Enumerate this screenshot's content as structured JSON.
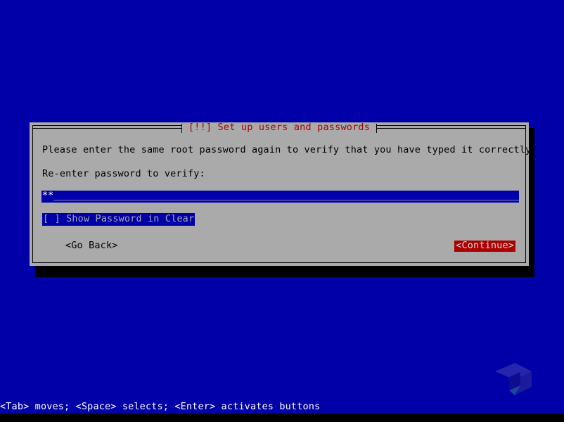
{
  "screen": {
    "background_color": "#0000a8",
    "text_color": "#ffffff"
  },
  "dialog": {
    "title": "[!!] Set up users and passwords",
    "title_color": "#aa0000",
    "background_color": "#aaaaaa",
    "prompt": "Please enter the same root password again to verify that you have typed it correctly.",
    "field_label": "Re-enter password to verify:",
    "password_field": {
      "masked_value": "**",
      "fill": "______________________________________________________________________________________",
      "background_color": "#0000a8",
      "text_color": "#ffffff"
    },
    "show_password": {
      "label": "[ ] Show Password in Clear",
      "checked": false,
      "highlight_color": "#0000a8",
      "text_color": "#aaaaaa"
    },
    "buttons": {
      "go_back": "<Go Back>",
      "continue": "<Continue>",
      "continue_background": "#aa0000",
      "continue_text_color": "#dddddd"
    }
  },
  "status_bar": {
    "text": "<Tab> moves; <Space> selects; <Enter> activates buttons",
    "background_color": "#0000a8",
    "text_color": "#ffffff"
  },
  "logo": {
    "name": "cube-logo",
    "color_light": "#2222aa",
    "color_mid": "#1a1a96",
    "color_dark": "#15158c"
  }
}
